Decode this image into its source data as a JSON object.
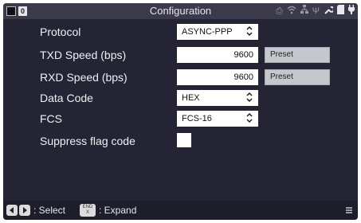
{
  "window": {
    "title": "Configuration",
    "left_indicator": "0"
  },
  "status_icons": [
    "printer-icon",
    "wifi-icon",
    "network-icon",
    "usb-icon",
    "wrench-icon",
    "sd-card-icon",
    "plug-icon"
  ],
  "settings": {
    "protocol": {
      "label": "Protocol",
      "value": "ASYNC-PPP"
    },
    "txd_speed": {
      "label": "TXD Speed (bps)",
      "value": "9600",
      "button": "Preset"
    },
    "rxd_speed": {
      "label": "RXD Speed (bps)",
      "value": "9600",
      "button": "Preset"
    },
    "data_code": {
      "label": "Data Code",
      "value": "HEX"
    },
    "fcs": {
      "label": "FCS",
      "value": "FCS-16"
    },
    "suppress_flag": {
      "label": "Suppress flag code",
      "checked": false
    }
  },
  "footer": {
    "select_label": ": Select",
    "end_key_line1": "END",
    "end_key_line2": "X",
    "expand_label": ": Expand"
  }
}
